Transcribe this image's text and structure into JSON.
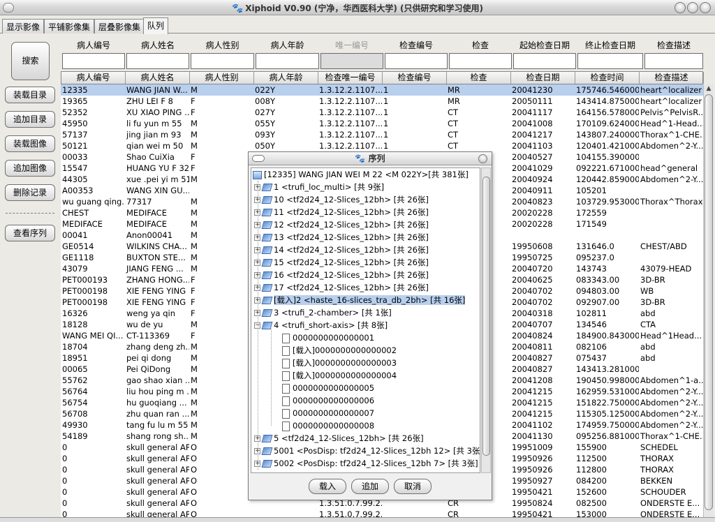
{
  "title": "Xiphoid V0.90 (宁净，华西医科大学) (只供研究和学习使用)",
  "tabs": [
    "显示影像",
    "平铺影像集",
    "层叠影像集",
    "队列"
  ],
  "left_buttons": {
    "search": "搜索",
    "load_catalog": "装载目录",
    "append_catalog": "追加目录",
    "load_image": "装载图像",
    "append_image": "追加图像",
    "delete_record": "删除记录",
    "view_series": "查看序列"
  },
  "filter_labels": [
    "病人编号",
    "病人姓名",
    "病人性别",
    "病人年龄",
    "唯一编号",
    "检查编号",
    "检查",
    "起始检查日期",
    "终止检查日期",
    "检查描述"
  ],
  "columns": [
    "病人编号",
    "病人姓名",
    "病人性别",
    "病人年龄",
    "检查唯一编号",
    "检查编号",
    "检查",
    "检查日期",
    "检查时间",
    "检查描述"
  ],
  "rows": [
    [
      "12335",
      "WANG JIAN W...",
      "M",
      "022Y",
      "1.3.12.2.1107....",
      "1",
      "MR",
      "20041230",
      "175746.546000",
      "heart^localizer"
    ],
    [
      "19365",
      "ZHU LEI F 8",
      "F",
      "008Y",
      "1.3.12.2.1107....",
      "1",
      "MR",
      "20050111",
      "143414.875000",
      "heart^localizer"
    ],
    [
      "52352",
      "XU XIAO PING ...",
      "F",
      "027Y",
      "1.3.12.2.1107....",
      "1",
      "CT",
      "20041117",
      "164156.578000",
      "Pelvis^PelvisR..."
    ],
    [
      "45950",
      "li fu yun m 55",
      "M",
      "055Y",
      "1.3.12.2.1107....",
      "1",
      "CT",
      "20041008",
      "170109.624000",
      "Head^1-Head..."
    ],
    [
      "57137",
      "jing jian m 93",
      "M",
      "093Y",
      "1.3.12.2.1107....",
      "1",
      "CT",
      "20041217",
      "143807.240000",
      "Thorax^1-CHE..."
    ],
    [
      "50121",
      "qian wei m 50",
      "M",
      "050Y",
      "1.3.12.2.1107....",
      "1",
      "CT",
      "20041103",
      "120401.421000",
      "Abdomen^2-Y..."
    ],
    [
      "00033",
      "Shao CuiXia",
      "F",
      "",
      "",
      "",
      "",
      "20040527",
      "104155.390000",
      ""
    ],
    [
      "15547",
      "HUANG YU F 32",
      "F",
      "",
      "",
      "",
      "",
      "20041029",
      "092221.671000",
      "head^general"
    ],
    [
      "44305",
      "xue .pei yi m 51",
      "M",
      "",
      "",
      "",
      "",
      "20040924",
      "120442.859000",
      "Abdomen^2-Y..."
    ],
    [
      "A00353",
      "WANG XIN GU...",
      "",
      "",
      "",
      "",
      "",
      "20040911",
      "105201",
      ""
    ],
    [
      "wu guang qing...",
      "77317",
      "M",
      "",
      "",
      "",
      "",
      "20040823",
      "103729.953000",
      "Thorax^Thorax..."
    ],
    [
      "CHEST",
      "MEDIFACE",
      "M",
      "",
      "",
      "",
      "",
      "20020228",
      "172559",
      ""
    ],
    [
      "MEDIFACE",
      "MEDIFACE",
      "M",
      "",
      "",
      "",
      "",
      "20020228",
      "171549",
      ""
    ],
    [
      "00041",
      "Anon00041",
      "M",
      "",
      "",
      "",
      "",
      "",
      "",
      ""
    ],
    [
      "GE0514",
      "WILKINS CHA...",
      "M",
      "",
      "",
      "",
      "",
      "19950608",
      "131646.0",
      "CHEST/ABD"
    ],
    [
      "GE1118",
      "BUXTON STE...",
      "M",
      "",
      "",
      "",
      "",
      "19950725",
      "095237.0",
      ""
    ],
    [
      "43079",
      "JIANG FENG ...",
      "M",
      "",
      "",
      "",
      "",
      "20040720",
      "143743",
      "43079-HEAD"
    ],
    [
      "PET000193",
      "ZHANG HONG...",
      "F",
      "",
      "",
      "",
      "",
      "20040625",
      "083343.00",
      "3D-BR"
    ],
    [
      "PET000198",
      "XIE FENG YING",
      "F",
      "",
      "",
      "",
      "",
      "20040702",
      "094803.00",
      "WB"
    ],
    [
      "PET000198",
      "XIE FENG YING",
      "F",
      "",
      "",
      "",
      "",
      "20040702",
      "092907.00",
      "3D-BR"
    ],
    [
      "16326",
      "weng ya qin",
      "F",
      "",
      "",
      "",
      "",
      "20040318",
      "102811",
      "abd"
    ],
    [
      "18128",
      "wu de yu",
      "M",
      "",
      "",
      "",
      "",
      "20040707",
      "134546",
      "CTA"
    ],
    [
      "WANG MEI QI...",
      "CT-113369",
      "F",
      "",
      "",
      "",
      "",
      "20040824",
      "184900.843000",
      "Head^1Head..."
    ],
    [
      "18704",
      "zhang deng zh...",
      "M",
      "",
      "",
      "",
      "",
      "20040811",
      "082106",
      "abd"
    ],
    [
      "18951",
      "pei qi dong",
      "M",
      "",
      "",
      "",
      "",
      "20040827",
      "075437",
      "abd"
    ],
    [
      "00065",
      "Pei QiDong",
      "M",
      "",
      "",
      "",
      "",
      "20040827",
      "143413.281000",
      ""
    ],
    [
      "55762",
      "gao shao xian ...",
      "M",
      "",
      "",
      "",
      "",
      "20041208",
      "190450.998000",
      "Abdomen^1-a..."
    ],
    [
      "56764",
      "liu hou ping m ...",
      "M",
      "",
      "",
      "",
      "",
      "20041215",
      "162959.531000",
      "Abdomen^2-Y..."
    ],
    [
      "56754",
      "hu guoqiang ...",
      "M",
      "",
      "",
      "",
      "",
      "20041215",
      "151822.750000",
      "Abdomen^2-Y..."
    ],
    [
      "56708",
      "zhu quan ran ...",
      "M",
      "",
      "",
      "",
      "",
      "20041215",
      "115305.125000",
      "Abdomen^2-Y..."
    ],
    [
      "49930",
      "tang fu lu m 55",
      "M",
      "",
      "",
      "",
      "",
      "20041102",
      "174959.750000",
      "Abdomen^2-Y..."
    ],
    [
      "54189",
      "shang rong sh...",
      "M",
      "",
      "",
      "",
      "",
      "20041130",
      "095256.881000",
      "Thorax^1-CHE..."
    ],
    [
      "0",
      "skull general AP",
      "O",
      "",
      "",
      "",
      "",
      "19951009",
      "155900",
      "SCHEDEL"
    ],
    [
      "0",
      "skull general AP",
      "O",
      "",
      "",
      "",
      "",
      "19950926",
      "112500",
      "THORAX"
    ],
    [
      "0",
      "skull general AP",
      "O",
      "",
      "",
      "",
      "",
      "19950926",
      "112800",
      "THORAX"
    ],
    [
      "0",
      "skull general AP",
      "O",
      "",
      "",
      "",
      "",
      "19950927",
      "084200",
      "BEKKEN"
    ],
    [
      "0",
      "skull general AP",
      "O",
      "",
      "",
      "",
      "",
      "19950421",
      "152600",
      "SCHOUDER"
    ],
    [
      "0",
      "skull general AP",
      "O",
      "",
      "1.3.51.0.7.99.2...",
      "",
      "CR",
      "19950824",
      "082500",
      "ONDERSTE E..."
    ],
    [
      "0",
      "skull general AP",
      "O",
      "",
      "1.3.51.0.7.99.2...",
      "",
      "CR",
      "19950421",
      "153000",
      "ONDERSTE E..."
    ]
  ],
  "dialog": {
    "title": "序列",
    "root": "[12335] WANG JIAN WEI M 22 <M 022Y>[共 381张]",
    "series_top": [
      "1 <trufi_loc_multi> [共 9张]",
      "10 <tf2d24_12-Slices_12bh> [共 26张]",
      "11 <tf2d24_12-Slices_12bh> [共 26张]",
      "12 <tf2d24_12-Slices_12bh> [共 26张]",
      "13 <tf2d24_12-Slices_12bh> [共 26张]",
      "14 <tf2d24_12-Slices_12bh> [共 26张]",
      "15 <tf2d24_12-Slices_12bh> [共 26张]",
      "16 <tf2d24_12-Slices_12bh> [共 26张]",
      "17 <tf2d24_12-Slices_12bh> [共 26张]",
      "[载入]2 <haste_16-slices_tra_db_2bh> [共 16张]",
      "3 <trufi_2-chamber> [共 1张]",
      "4 <trufi_short-axis> [共 8张]"
    ],
    "images": [
      "0000000000000001",
      "[载入]0000000000000002",
      "[载入]0000000000000003",
      "[载入]0000000000000004",
      "0000000000000005",
      "0000000000000006",
      "0000000000000007",
      "0000000000000008"
    ],
    "series_bottom": [
      "5 <tf2d24_12-Slices_12bh> [共 26张]",
      "5001 <PosDisp: tf2d24_12-Slices_12bh 12> [共 3张]",
      "5002 <PosDisp: tf2d24_12-Slices_12bh 7> [共 3张]"
    ],
    "buttons": {
      "load": "载入",
      "append": "追加",
      "cancel": "取消"
    }
  }
}
